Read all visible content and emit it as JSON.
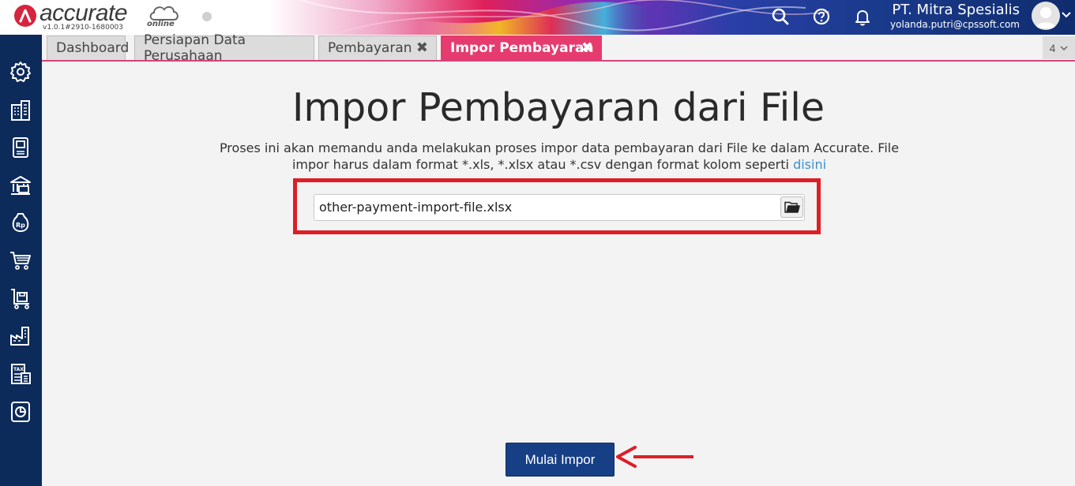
{
  "app": {
    "logo_text": "accurate",
    "logo_suffix": "online",
    "version": "v1.0.1#2910-1680003",
    "company_name": "PT. Mitra Spesialis",
    "user_email": "yolanda.putri@cpssoft.com",
    "top_icons": [
      "search-icon",
      "help-icon",
      "bell-icon"
    ]
  },
  "tabs": [
    {
      "label": "Dashboard",
      "closable": false
    },
    {
      "label": "Persiapan Data Perusahaan",
      "closable": false
    },
    {
      "label": "Pembayaran",
      "closable": true
    },
    {
      "label": "Impor Pembayaran",
      "closable": true,
      "active": true
    }
  ],
  "tab_count": "4",
  "sidebar_icons": [
    "settings-icon",
    "company-icon",
    "ledger-icon",
    "bank-icon",
    "cash-bag-icon",
    "cart-icon",
    "inventory-cart-icon",
    "factory-icon",
    "tax-icon",
    "report-icon"
  ],
  "page": {
    "title": "Impor Pembayaran dari File",
    "description": "Proses ini akan memandu anda melakukan proses impor data pembayaran dari File ke dalam Accurate. File impor harus dalam format *.xls, *.xlsx atau *.csv dengan format kolom seperti",
    "description_link": "disini",
    "file_value": "other-payment-import-file.xlsx",
    "start_button": "Mulai Impor"
  },
  "colors": {
    "sidebar": "#0c2a5a",
    "active_tab": "#e63b6e",
    "primary_button": "#173f86",
    "highlight": "#dd1e26",
    "link": "#3a8fd0"
  }
}
